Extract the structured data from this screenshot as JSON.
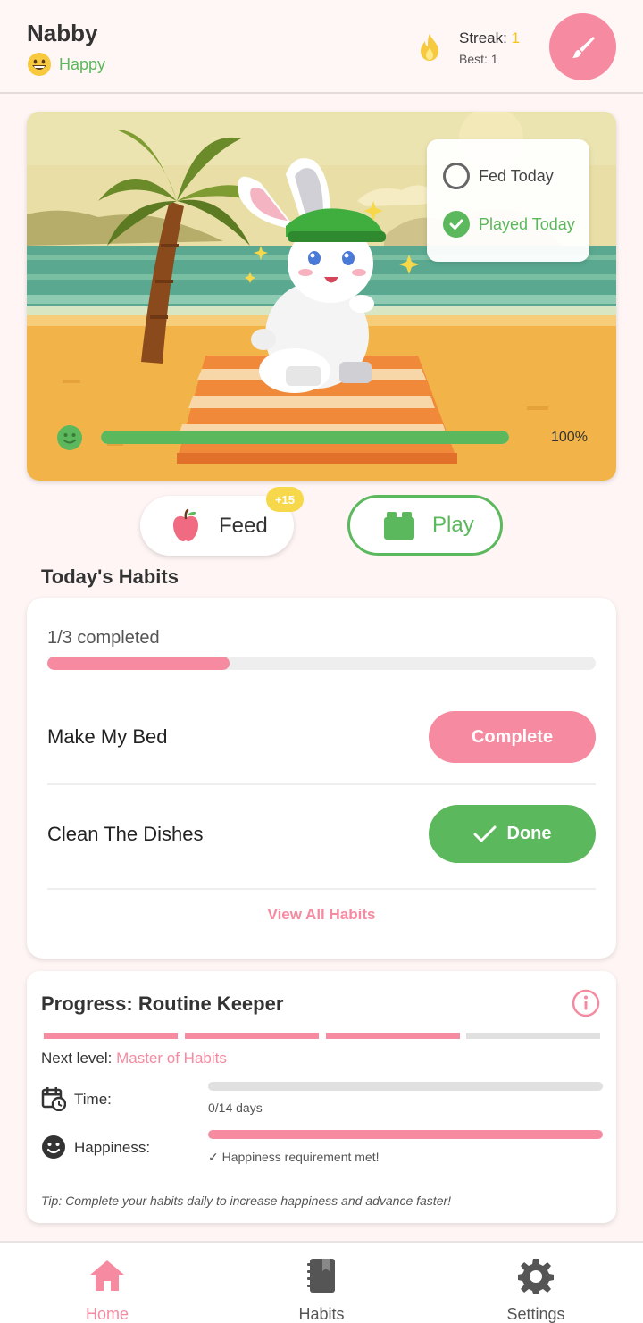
{
  "header": {
    "pet_name": "Nabby",
    "mood_icon": "grinning-face-emoji",
    "mood_label": "Happy",
    "streak_icon": "flame-icon",
    "streak_label": "Streak: ",
    "streak_value": "1",
    "best_label": "Best: 1",
    "customize_icon": "paintbrush-icon"
  },
  "scene": {
    "image": "pixel-art-beach-bunny",
    "status": {
      "fed_label": "Fed Today",
      "fed_checked": false,
      "played_label": "Played Today",
      "played_checked": true
    },
    "happiness_icon": "smiley-face-icon",
    "happiness_value": 1.0,
    "happiness_label": "100%"
  },
  "actions": {
    "feed_icon": "apple-icon",
    "feed_label": "Feed",
    "feed_bonus": "+15",
    "play_icon": "toy-blocks-icon",
    "play_label": "Play"
  },
  "habits": {
    "title": "Today's Habits",
    "completed_text": "1/3 completed",
    "progress": 0.333,
    "items": [
      {
        "name": "Make My Bed",
        "button": "Complete",
        "done": false
      },
      {
        "name": "Clean The Dishes",
        "button": "Done",
        "done": true
      }
    ],
    "view_all": "View All Habits"
  },
  "progress": {
    "title": "Progress: Routine Keeper",
    "info_icon": "info-icon",
    "segments_filled": 3,
    "segments_total": 4,
    "next_level_label": "Next level: ",
    "next_level_name": "Master of Habits",
    "time_icon": "calendar-clock-icon",
    "time_label": "Time:",
    "time_progress": 0.0,
    "time_note": "0/14 days",
    "happiness_icon": "smiley-face-icon",
    "happiness_label": "Happiness:",
    "happiness_progress": 1.0,
    "happiness_note": "✓ Happiness requirement met!",
    "tip": "Tip: Complete your habits daily to increase happiness and advance faster!"
  },
  "nav": {
    "home_label": "Home",
    "home_icon": "house-icon",
    "habits_label": "Habits",
    "habits_icon": "notebook-icon",
    "settings_label": "Settings",
    "settings_icon": "gear-icon",
    "active": "home"
  },
  "colors": {
    "accent_pink": "#f68aa0",
    "accent_green": "#5cb85c",
    "streak_yellow": "#f5c518",
    "background": "#fff5f5"
  }
}
